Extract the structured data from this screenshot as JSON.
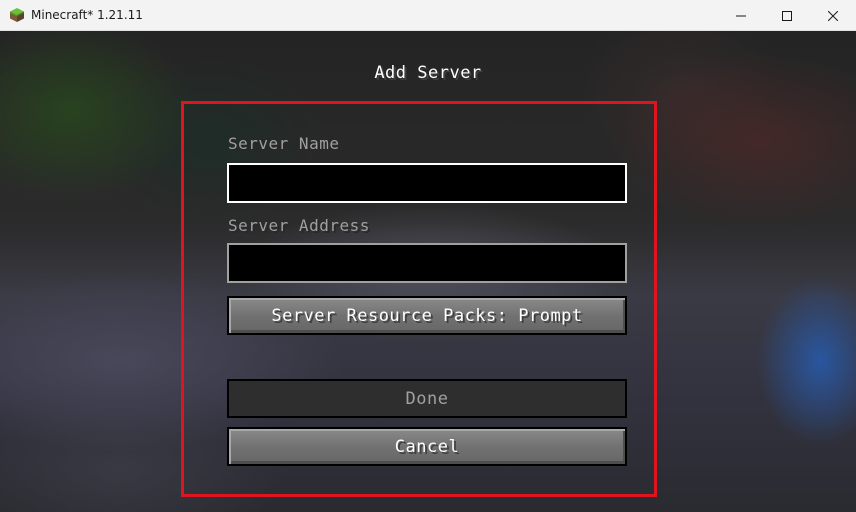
{
  "window": {
    "title": "Minecraft* 1.21.11",
    "app_icon": "minecraft-grass-block-icon",
    "controls": {
      "minimize_icon": "minimize-icon",
      "maximize_icon": "maximize-icon",
      "close_icon": "close-icon"
    }
  },
  "screen": {
    "title": "Add Server",
    "highlight_color": "#e0141e"
  },
  "form": {
    "server_name": {
      "label": "Server Name",
      "value": ""
    },
    "server_address": {
      "label": "Server Address",
      "value": ""
    },
    "resource_packs_button": "Server Resource Packs: Prompt",
    "done_button": "Done",
    "cancel_button": "Cancel"
  }
}
